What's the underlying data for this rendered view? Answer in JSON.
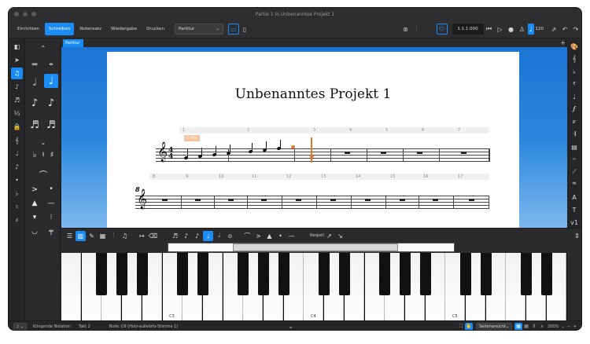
{
  "window": {
    "title": "Partie 1 in Unbenanntes Projekt 1"
  },
  "toolbar": {
    "modes": [
      "Einrichten",
      "Schreiben",
      "Notensatz",
      "Wiedergabe",
      "Drucken"
    ],
    "active_mode": "Schreiben",
    "layout_select": "Partitur",
    "position": "1.1.1.000",
    "tempo": "120"
  },
  "tabs": {
    "active": "Partitur"
  },
  "score": {
    "title": "Unbenanntes Projekt 1",
    "key_label": "C Dur",
    "system1_bars": [
      "1",
      "2",
      "3",
      "4",
      "5",
      "6",
      "7"
    ],
    "system2_bars": [
      "8",
      "9",
      "10",
      "11",
      "12",
      "13",
      "14",
      "15",
      "16",
      "17"
    ],
    "system2_number": "8"
  },
  "keyboard": {
    "labels": [
      "C3",
      "C4",
      "C5"
    ]
  },
  "lower_toolbar": {
    "label": "Respell"
  },
  "status": {
    "notation": "Klingende Notation",
    "bar": "Takt 2",
    "note": "Note: C6 (Holz-aufwärts-Stimme 1)",
    "view": "Seitenansicht",
    "zoom": "200%"
  }
}
